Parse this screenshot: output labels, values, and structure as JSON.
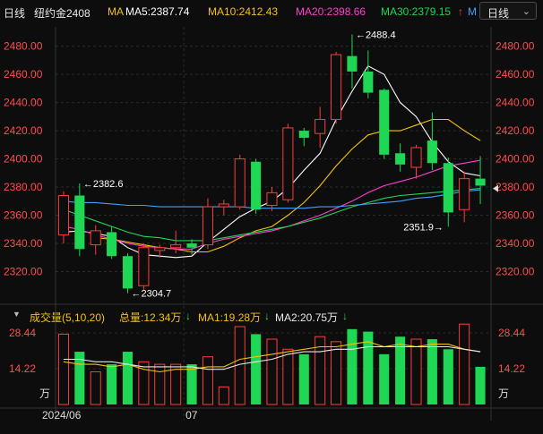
{
  "header": {
    "period": "日线",
    "symbol": "纽约金2408",
    "ma_label": "MA",
    "ma5": "MA5:2387.74",
    "ma10": "MA10:2412.43",
    "ma20": "MA20:2398.66",
    "ma30": "MA30:2379.15",
    "ma30_arrow": "↑",
    "ma_extra": "M",
    "dropdown_label": "日线",
    "dropdown_icon": "chevron-down-icon"
  },
  "volume_header": {
    "toggle_icon": "triangle-down-icon",
    "title": "成交量(5,10,20)",
    "total": "总量:12.34万",
    "total_arrow": "↓",
    "ma1": "MA1:19.28万",
    "ma1_arrow": "↓",
    "ma2": "MA2:20.75万",
    "ma2_arrow": "↓"
  },
  "colors": {
    "up": "#ff3b3b",
    "down": "#1fd655",
    "ma5": "#ffffff",
    "ma10": "#f4c20d",
    "ma20": "#ff3fd0",
    "ma30": "#1fd655",
    "ma60": "#3ea0ff"
  },
  "chart_data": [
    {
      "type": "candlestick",
      "y_ticks": [
        "2320.00",
        "2340.00",
        "2360.00",
        "2380.00",
        "2400.00",
        "2420.00",
        "2440.00",
        "2460.00",
        "2480.00"
      ],
      "ylim": [
        2300,
        2495
      ],
      "annotations": [
        {
          "text": "←2382.6",
          "value": 2382.6
        },
        {
          "text": "←2304.7",
          "value": 2304.7
        },
        {
          "text": "←2488.4",
          "value": 2488.4
        },
        {
          "text": "2351.9→",
          "value": 2351.9
        }
      ],
      "candles": [
        {
          "o": 2346,
          "c": 2374,
          "h": 2377,
          "l": 2340
        },
        {
          "o": 2374,
          "c": 2336,
          "h": 2382.6,
          "l": 2331
        },
        {
          "o": 2339,
          "c": 2349,
          "h": 2353,
          "l": 2332
        },
        {
          "o": 2348,
          "c": 2331,
          "h": 2352,
          "l": 2329
        },
        {
          "o": 2331,
          "c": 2308,
          "h": 2333,
          "l": 2304.7
        },
        {
          "o": 2310,
          "c": 2337,
          "h": 2340,
          "l": 2307
        },
        {
          "o": 2335,
          "c": 2337,
          "h": 2339,
          "l": 2330
        },
        {
          "o": 2337,
          "c": 2339,
          "h": 2349,
          "l": 2333
        },
        {
          "o": 2340,
          "c": 2337,
          "h": 2343,
          "l": 2332
        },
        {
          "o": 2339,
          "c": 2366,
          "h": 2372,
          "l": 2336
        },
        {
          "o": 2366,
          "c": 2368,
          "h": 2371,
          "l": 2360
        },
        {
          "o": 2366,
          "c": 2400,
          "h": 2403,
          "l": 2364
        },
        {
          "o": 2398,
          "c": 2364,
          "h": 2400,
          "l": 2361
        },
        {
          "o": 2367,
          "c": 2376,
          "h": 2380,
          "l": 2363
        },
        {
          "o": 2371,
          "c": 2422,
          "h": 2425,
          "l": 2369
        },
        {
          "o": 2420,
          "c": 2415,
          "h": 2422,
          "l": 2409
        },
        {
          "o": 2418,
          "c": 2428,
          "h": 2437,
          "l": 2408
        },
        {
          "o": 2428,
          "c": 2474,
          "h": 2476,
          "l": 2425
        },
        {
          "o": 2473,
          "c": 2462,
          "h": 2488.4,
          "l": 2450
        },
        {
          "o": 2462,
          "c": 2447,
          "h": 2477,
          "l": 2443
        },
        {
          "o": 2449,
          "c": 2403,
          "h": 2450,
          "l": 2400
        },
        {
          "o": 2404,
          "c": 2396,
          "h": 2411,
          "l": 2391
        },
        {
          "o": 2394,
          "c": 2408,
          "h": 2410,
          "l": 2386
        },
        {
          "o": 2413,
          "c": 2397,
          "h": 2433,
          "l": 2392
        },
        {
          "o": 2397,
          "c": 2362,
          "h": 2401,
          "l": 2351.9
        },
        {
          "o": 2364,
          "c": 2386,
          "h": 2391,
          "l": 2355
        },
        {
          "o": 2386,
          "c": 2381,
          "h": 2402,
          "l": 2368
        }
      ],
      "ma_lines": {
        "ma5": [
          2348,
          2349,
          2347,
          2345,
          2337,
          2332,
          2331,
          2330,
          2331,
          2341,
          2350,
          2359,
          2365,
          2370,
          2379,
          2392,
          2404,
          2428,
          2448,
          2466,
          2460,
          2440,
          2430,
          2412,
          2398,
          2390,
          2388
        ],
        "ma10": [
          null,
          null,
          2344,
          2343,
          2341,
          2339,
          2337,
          2336,
          2334,
          2334,
          2338,
          2344,
          2349,
          2352,
          2360,
          2369,
          2381,
          2395,
          2407,
          2417,
          2420,
          2420,
          2424,
          2428,
          2428,
          2420,
          2413
        ],
        "ma20": [
          2352,
          2350,
          2346,
          2343,
          2340,
          2338,
          2337,
          2336,
          2336,
          2340,
          2343,
          2345,
          2347,
          2349,
          2352,
          2356,
          2360,
          2365,
          2370,
          2376,
          2381,
          2384,
          2387,
          2391,
          2395,
          2397,
          2399
        ],
        "ma30": [
          2364,
          2360,
          2356,
          2352,
          2348,
          2345,
          2344,
          2342,
          2342,
          2342,
          2344,
          2346,
          2348,
          2350,
          2352,
          2355,
          2358,
          2362,
          2366,
          2369,
          2372,
          2374,
          2375,
          2376,
          2377,
          2378,
          2379
        ],
        "ma60": [
          2370,
          2369,
          2369,
          2368,
          2367,
          2367,
          2366,
          2366,
          2366,
          2366,
          2366,
          2366,
          2365,
          2365,
          2365,
          2365,
          2366,
          2366,
          2367,
          2368,
          2369,
          2370,
          2372,
          2373,
          2375,
          2377,
          2378
        ]
      }
    },
    {
      "type": "bar",
      "y_ticks": [
        "28.44",
        "14.22"
      ],
      "unit": "万",
      "x_ticks": [
        "2024/06",
        "07"
      ],
      "ylim": [
        0,
        31
      ],
      "values": [
        28,
        21,
        13,
        16,
        21,
        17,
        16,
        16,
        16,
        19,
        7,
        31,
        28,
        26,
        22,
        20,
        27,
        25,
        30,
        29,
        20,
        27,
        26,
        26,
        22,
        32,
        15
      ],
      "ma1": [
        17,
        16,
        16,
        15,
        16,
        14,
        13,
        14,
        14,
        15,
        15,
        18,
        19,
        20,
        21,
        22,
        23,
        23,
        24,
        25,
        23,
        24,
        23,
        24,
        24,
        22,
        21
      ],
      "ma2": [
        18,
        18,
        17,
        17,
        16,
        15,
        15,
        15,
        15,
        14,
        14,
        16,
        17,
        18,
        20,
        21,
        21,
        22,
        22,
        23,
        23,
        23,
        23,
        23,
        23,
        22,
        21
      ]
    }
  ]
}
